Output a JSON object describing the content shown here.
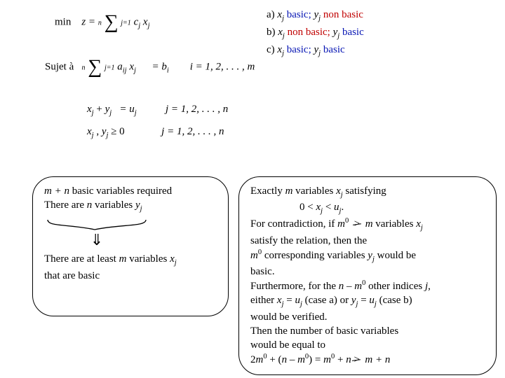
{
  "top_math": {
    "min_line": {
      "min": "min",
      "z_eq": "z =",
      "sum_top": "n",
      "sum_bot": "j=1",
      "term": "c",
      "term_sub": "j",
      "x": "x",
      "x_sub": "j"
    },
    "sujet": "Sujet à",
    "constraint1": {
      "sum_top": "n",
      "sum_bot": "j=1",
      "a": "a",
      "a_sub": "ij",
      "x": "x",
      "x_sub": "j",
      "eq": "=",
      "b": "b",
      "b_sub": "i",
      "range": "i = 1, 2, . . . , m"
    },
    "constraint2": {
      "lhs": "x",
      "lhs_sub": "j",
      "plus": " + ",
      "y": "y",
      "y_sub": "j",
      "eq": "= ",
      "u": "u",
      "u_sub": "j",
      "range": "j = 1, 2, . . . , n"
    },
    "constraint3": {
      "x": "x",
      "x_sub": "j",
      "comma": " , ",
      "y": "y",
      "y_sub": "j",
      "geq": " ≥ 0",
      "range": "j = 1, 2, . . . , n"
    }
  },
  "cases": {
    "a": {
      "lbl": "a) ",
      "x": "x",
      "xsub": "j",
      "xs": " basic; ",
      "y": "y",
      "ysub": "j",
      "ys": " non basic"
    },
    "b": {
      "lbl": "b) ",
      "x": "x",
      "xsub": "j",
      "xs": " non basic; ",
      "y": "y",
      "ysub": "j",
      "ys": " basic"
    },
    "c": {
      "lbl": "c) ",
      "x": "x",
      "xsub": "j",
      "xs": " basic; ",
      "y": "y",
      "ysub": "j",
      "ys": " basic"
    }
  },
  "left_bubble": {
    "line1a": "m + n",
    "line1b": " basic variables required",
    "line2a": "There are ",
    "line2b": "n",
    "line2c": " variables  ",
    "line2d": "y",
    "line2d_sub": "j",
    "line3a": "There are at least ",
    "line3b": "m",
    "line3c": " variables ",
    "line3d": "x",
    "line3d_sub": "j",
    "line4": "that are basic"
  },
  "right_bubble": {
    "l1a": "Exactly ",
    "l1b": "m",
    "l1c": " variables ",
    "l1d": "x",
    "l1d_sub": "j",
    "l1e": " satisfying",
    "l2a": "0 < ",
    "l2b": "x",
    "l2b_sub": "j",
    "l2c": " < ",
    "l2d": "u",
    "l2d_sub": "j",
    "l2e": ".",
    "l3a": "For contradiction, if  ",
    "l3b": "m",
    "l3b_sup": "0",
    "l3c": "m",
    "l3d": "variables ",
    "l3e": "x",
    "l3e_sub": "j",
    "l4": "satisfy the relation, then the",
    "l5a": "m",
    "l5a_sup": "0",
    "l5b": "  corresponding variables ",
    "l5c": "y",
    "l5c_sub": "j",
    "l5d": " would be",
    "l6": "basic.",
    "l7a": "Furthermore, for the ",
    "l7b": "n – m",
    "l7b_sup": "0",
    "l7c": " other indices ",
    "l7d": "j",
    "l8a": "either ",
    "l8b": "x",
    "l8b_sub": "j",
    "l8c": " = ",
    "l8d": "u",
    "l8d_sub": "j",
    "l8e": " (case a) or  ",
    "l8f": "y",
    "l8f_sub": "j",
    "l8g": " = ",
    "l8h": "u",
    "l8h_sub": "j",
    "l8i": "(case b)",
    "l9": "would be verified.",
    "l10": "Then the number of basic variables",
    "l11": "would be equal to",
    "l12a": " 2",
    "l12b": "m",
    "l12b_sup": "0",
    "l12c": " + (",
    "l12d": "n – m",
    "l12d_sup": "0",
    "l12e": ") = ",
    "l12f": "m",
    "l12f_sup": "0",
    "l12g": " + ",
    "l12h": "n  ",
    "l12i": "m  + n"
  }
}
